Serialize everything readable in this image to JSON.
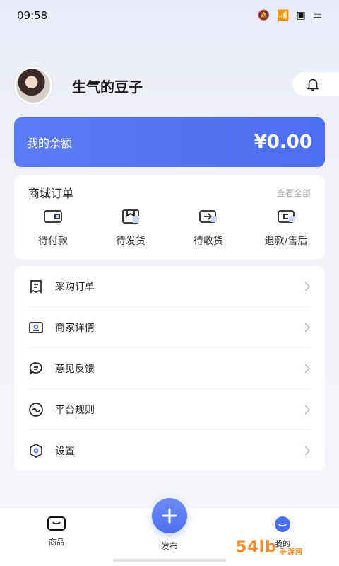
{
  "status": {
    "time": "09:58"
  },
  "profile": {
    "name": "生气的豆子"
  },
  "balance": {
    "label": "我的余额",
    "value": "¥0.00"
  },
  "orders": {
    "title": "商城订单",
    "view_all": "查看全部",
    "items": [
      {
        "label": "待付款",
        "icon": "wallet-icon"
      },
      {
        "label": "待发货",
        "icon": "box-icon"
      },
      {
        "label": "待收货",
        "icon": "truck-icon"
      },
      {
        "label": "退款/售后",
        "icon": "refund-icon"
      }
    ]
  },
  "menu": [
    {
      "label": "采购订单",
      "icon": "document-icon"
    },
    {
      "label": "商家详情",
      "icon": "id-card-icon"
    },
    {
      "label": "意见反馈",
      "icon": "message-icon"
    },
    {
      "label": "平台规则",
      "icon": "rules-icon"
    },
    {
      "label": "设置",
      "icon": "settings-hex-icon"
    }
  ],
  "tabbar": {
    "items": [
      {
        "label": "商品",
        "icon": "shop-icon"
      },
      {
        "label": "发布",
        "icon": "plus-icon"
      },
      {
        "label": "我的",
        "icon": "profile-icon"
      }
    ]
  },
  "watermark": {
    "text": "54lb",
    "sub": "手游网"
  },
  "colors": {
    "accent": "#4c6ef0",
    "background": "#f4f5f9"
  }
}
